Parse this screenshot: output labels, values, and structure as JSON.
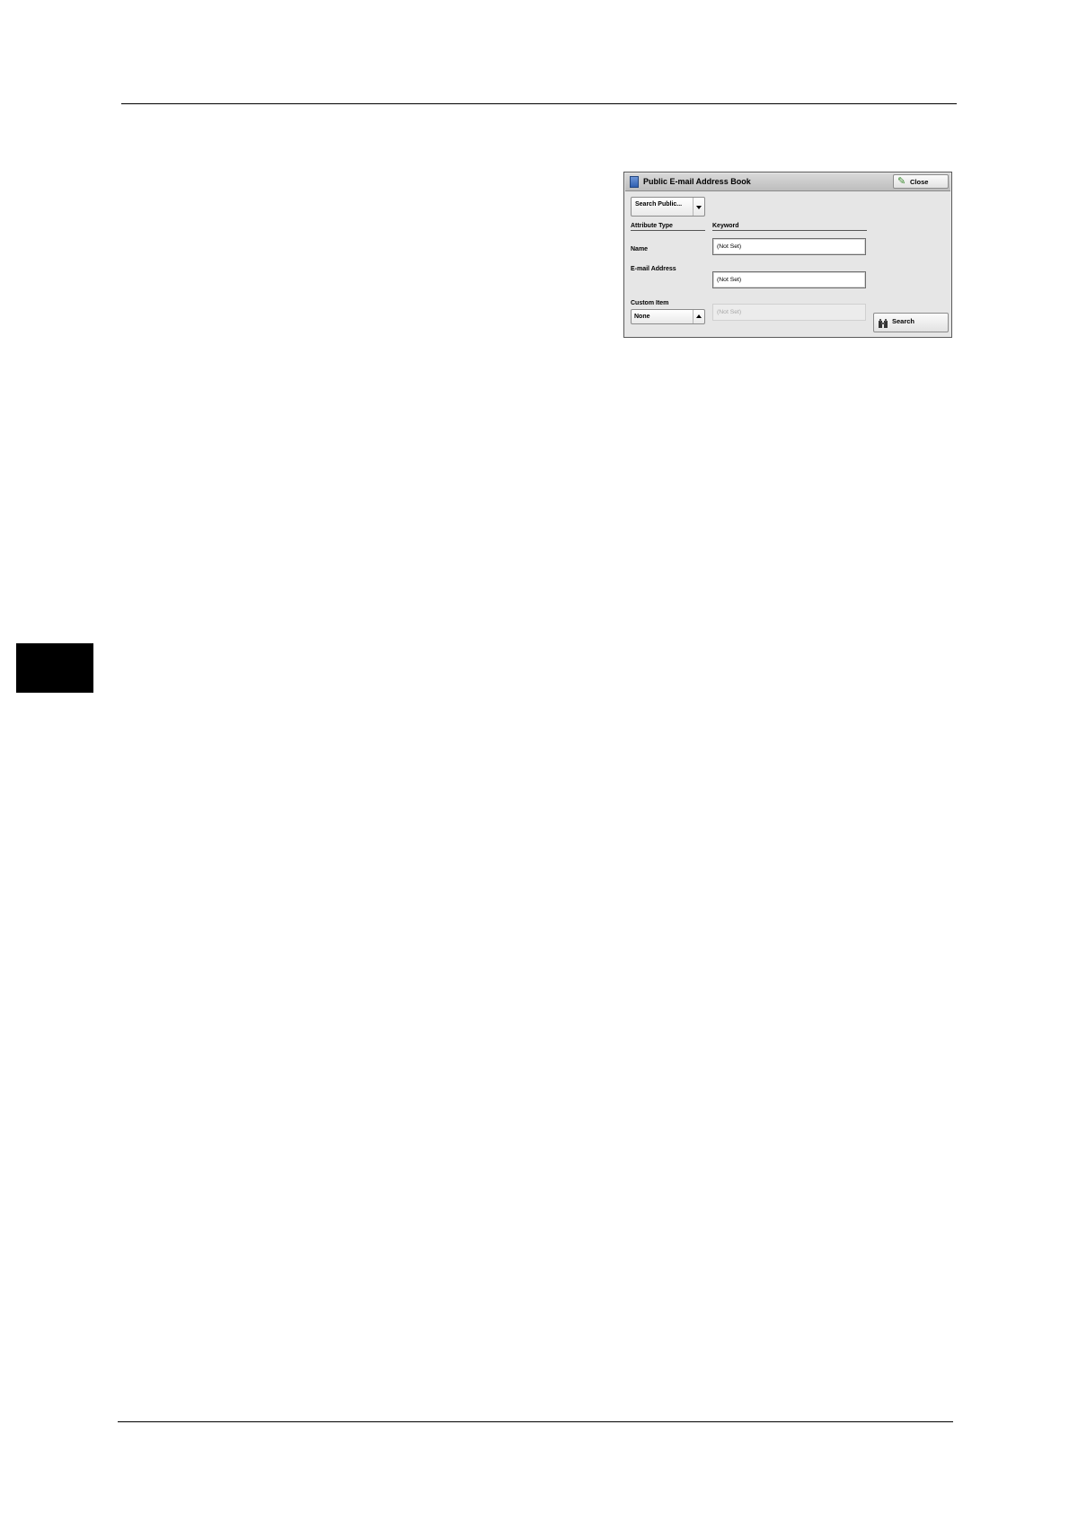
{
  "dialog": {
    "title": "Public E-mail Address Book",
    "close_label": "Close",
    "search_select_value": "Search Public...",
    "headers": {
      "attribute_type": "Attribute Type",
      "keyword": "Keyword"
    },
    "rows": {
      "name": {
        "label": "Name",
        "value": "(Not Set)"
      },
      "email": {
        "label": "E-mail Address",
        "value": "(Not Set)"
      },
      "custom": {
        "label": "Custom Item",
        "select_value": "None",
        "value": "(Not Set)"
      }
    },
    "search_label": "Search"
  },
  "icons": {
    "title": "address-book-icon",
    "close": "checkmark-pencil-icon",
    "search": "binoculars-icon",
    "search_select": "chevron-down-icon",
    "custom_select": "chevron-up-icon"
  }
}
